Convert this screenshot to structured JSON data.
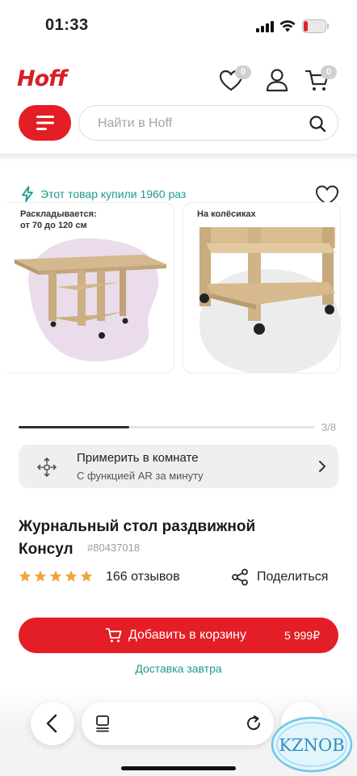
{
  "status_bar": {
    "time": "01:33",
    "battery": "16"
  },
  "header": {
    "logo": "Hoff",
    "favorites_count": "0",
    "cart_count": "0",
    "search_placeholder": "Найти в Hoff"
  },
  "gallery": {
    "bought_text": "Этот товар купили 1960 раз",
    "card1_caption_line1": "Раскладывается:",
    "card1_caption_line2": "от 70 до 120 см",
    "card2_caption": "На колёсиках",
    "counter": "3/8",
    "progress": 0.375
  },
  "ar": {
    "title": "Примерить в комнате",
    "subtitle": "С  функцией AR за минуту"
  },
  "product": {
    "title_line1": "Журнальный стол раздвижной",
    "title_line2": "Консул",
    "sku": "#80437018",
    "rating": 5,
    "reviews": "166 отзывов",
    "share": "Поделиться"
  },
  "buy": {
    "label": "Добавить в корзину",
    "price": "5 999₽",
    "delivery": "Доставка завтра"
  },
  "watermark": "KZNOB",
  "colors": {
    "brand_red": "#e31e26",
    "accent_teal": "#1d9a8a",
    "star": "#f2a33a"
  },
  "icons": [
    "signal-icon",
    "wifi-icon",
    "battery-icon",
    "heart-icon",
    "user-icon",
    "cart-icon",
    "menu-icon",
    "search-icon",
    "lightning-icon",
    "ar-icon",
    "chevron-right-icon",
    "star-icon",
    "share-icon",
    "back-icon",
    "tabs-icon",
    "reload-icon",
    "more-icon"
  ]
}
